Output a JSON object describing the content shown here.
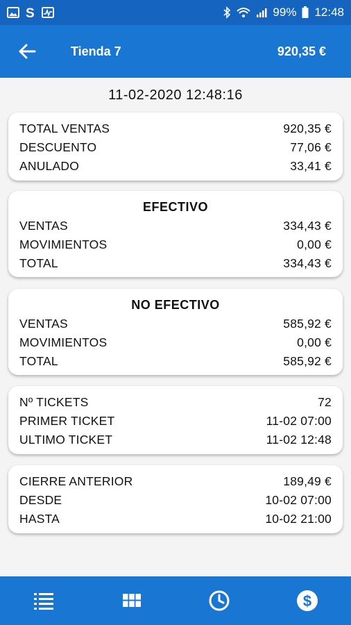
{
  "status_bar": {
    "battery": "99%",
    "time": "12:48"
  },
  "header": {
    "title": "Tienda 7",
    "total": "920,35 €"
  },
  "date": "11-02-2020 12:48:16",
  "summary": {
    "rows": [
      {
        "label": "TOTAL VENTAS",
        "value": "920,35 €"
      },
      {
        "label": "DESCUENTO",
        "value": "77,06 €"
      },
      {
        "label": "ANULADO",
        "value": "33,41 €"
      }
    ]
  },
  "efectivo": {
    "title": "EFECTIVO",
    "rows": [
      {
        "label": "VENTAS",
        "value": "334,43 €"
      },
      {
        "label": "MOVIMIENTOS",
        "value": "0,00 €"
      },
      {
        "label": "TOTAL",
        "value": "334,43 €"
      }
    ]
  },
  "no_efectivo": {
    "title": "NO EFECTIVO",
    "rows": [
      {
        "label": "VENTAS",
        "value": "585,92 €"
      },
      {
        "label": "MOVIMIENTOS",
        "value": "0,00 €"
      },
      {
        "label": "TOTAL",
        "value": "585,92 €"
      }
    ]
  },
  "tickets": {
    "rows": [
      {
        "label": "Nº TICKETS",
        "value": "72"
      },
      {
        "label": "PRIMER TICKET",
        "value": "11-02 07:00"
      },
      {
        "label": "ULTIMO TICKET",
        "value": "11-02 12:48"
      }
    ]
  },
  "cierre": {
    "rows": [
      {
        "label": "CIERRE ANTERIOR",
        "value": "189,49 €"
      },
      {
        "label": "DESDE",
        "value": "10-02 07:00"
      },
      {
        "label": "HASTA",
        "value": "10-02 21:00"
      }
    ]
  },
  "bottom_nav": {
    "items": [
      {
        "icon": "list-icon"
      },
      {
        "icon": "grid-icon"
      },
      {
        "icon": "clock-icon"
      },
      {
        "icon": "dollar-icon"
      }
    ]
  },
  "colors": {
    "app_bar": "#1976d2",
    "status_bar": "#1565c0",
    "background": "#f4f4f4"
  }
}
